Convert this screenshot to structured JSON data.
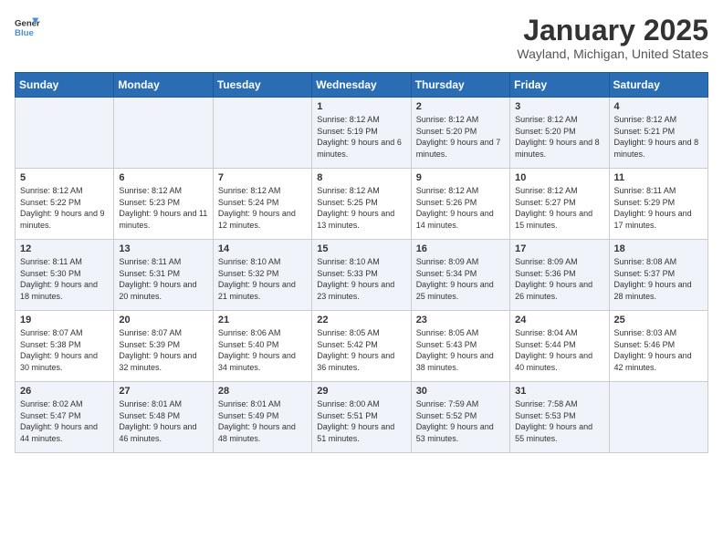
{
  "logo": {
    "general": "General",
    "blue": "Blue"
  },
  "header": {
    "title": "January 2025",
    "subtitle": "Wayland, Michigan, United States"
  },
  "weekdays": [
    "Sunday",
    "Monday",
    "Tuesday",
    "Wednesday",
    "Thursday",
    "Friday",
    "Saturday"
  ],
  "weeks": [
    [
      {
        "day": "",
        "sunrise": "",
        "sunset": "",
        "daylight": ""
      },
      {
        "day": "",
        "sunrise": "",
        "sunset": "",
        "daylight": ""
      },
      {
        "day": "",
        "sunrise": "",
        "sunset": "",
        "daylight": ""
      },
      {
        "day": "1",
        "sunrise": "Sunrise: 8:12 AM",
        "sunset": "Sunset: 5:19 PM",
        "daylight": "Daylight: 9 hours and 6 minutes."
      },
      {
        "day": "2",
        "sunrise": "Sunrise: 8:12 AM",
        "sunset": "Sunset: 5:20 PM",
        "daylight": "Daylight: 9 hours and 7 minutes."
      },
      {
        "day": "3",
        "sunrise": "Sunrise: 8:12 AM",
        "sunset": "Sunset: 5:20 PM",
        "daylight": "Daylight: 9 hours and 8 minutes."
      },
      {
        "day": "4",
        "sunrise": "Sunrise: 8:12 AM",
        "sunset": "Sunset: 5:21 PM",
        "daylight": "Daylight: 9 hours and 8 minutes."
      }
    ],
    [
      {
        "day": "5",
        "sunrise": "Sunrise: 8:12 AM",
        "sunset": "Sunset: 5:22 PM",
        "daylight": "Daylight: 9 hours and 9 minutes."
      },
      {
        "day": "6",
        "sunrise": "Sunrise: 8:12 AM",
        "sunset": "Sunset: 5:23 PM",
        "daylight": "Daylight: 9 hours and 11 minutes."
      },
      {
        "day": "7",
        "sunrise": "Sunrise: 8:12 AM",
        "sunset": "Sunset: 5:24 PM",
        "daylight": "Daylight: 9 hours and 12 minutes."
      },
      {
        "day": "8",
        "sunrise": "Sunrise: 8:12 AM",
        "sunset": "Sunset: 5:25 PM",
        "daylight": "Daylight: 9 hours and 13 minutes."
      },
      {
        "day": "9",
        "sunrise": "Sunrise: 8:12 AM",
        "sunset": "Sunset: 5:26 PM",
        "daylight": "Daylight: 9 hours and 14 minutes."
      },
      {
        "day": "10",
        "sunrise": "Sunrise: 8:12 AM",
        "sunset": "Sunset: 5:27 PM",
        "daylight": "Daylight: 9 hours and 15 minutes."
      },
      {
        "day": "11",
        "sunrise": "Sunrise: 8:11 AM",
        "sunset": "Sunset: 5:29 PM",
        "daylight": "Daylight: 9 hours and 17 minutes."
      }
    ],
    [
      {
        "day": "12",
        "sunrise": "Sunrise: 8:11 AM",
        "sunset": "Sunset: 5:30 PM",
        "daylight": "Daylight: 9 hours and 18 minutes."
      },
      {
        "day": "13",
        "sunrise": "Sunrise: 8:11 AM",
        "sunset": "Sunset: 5:31 PM",
        "daylight": "Daylight: 9 hours and 20 minutes."
      },
      {
        "day": "14",
        "sunrise": "Sunrise: 8:10 AM",
        "sunset": "Sunset: 5:32 PM",
        "daylight": "Daylight: 9 hours and 21 minutes."
      },
      {
        "day": "15",
        "sunrise": "Sunrise: 8:10 AM",
        "sunset": "Sunset: 5:33 PM",
        "daylight": "Daylight: 9 hours and 23 minutes."
      },
      {
        "day": "16",
        "sunrise": "Sunrise: 8:09 AM",
        "sunset": "Sunset: 5:34 PM",
        "daylight": "Daylight: 9 hours and 25 minutes."
      },
      {
        "day": "17",
        "sunrise": "Sunrise: 8:09 AM",
        "sunset": "Sunset: 5:36 PM",
        "daylight": "Daylight: 9 hours and 26 minutes."
      },
      {
        "day": "18",
        "sunrise": "Sunrise: 8:08 AM",
        "sunset": "Sunset: 5:37 PM",
        "daylight": "Daylight: 9 hours and 28 minutes."
      }
    ],
    [
      {
        "day": "19",
        "sunrise": "Sunrise: 8:07 AM",
        "sunset": "Sunset: 5:38 PM",
        "daylight": "Daylight: 9 hours and 30 minutes."
      },
      {
        "day": "20",
        "sunrise": "Sunrise: 8:07 AM",
        "sunset": "Sunset: 5:39 PM",
        "daylight": "Daylight: 9 hours and 32 minutes."
      },
      {
        "day": "21",
        "sunrise": "Sunrise: 8:06 AM",
        "sunset": "Sunset: 5:40 PM",
        "daylight": "Daylight: 9 hours and 34 minutes."
      },
      {
        "day": "22",
        "sunrise": "Sunrise: 8:05 AM",
        "sunset": "Sunset: 5:42 PM",
        "daylight": "Daylight: 9 hours and 36 minutes."
      },
      {
        "day": "23",
        "sunrise": "Sunrise: 8:05 AM",
        "sunset": "Sunset: 5:43 PM",
        "daylight": "Daylight: 9 hours and 38 minutes."
      },
      {
        "day": "24",
        "sunrise": "Sunrise: 8:04 AM",
        "sunset": "Sunset: 5:44 PM",
        "daylight": "Daylight: 9 hours and 40 minutes."
      },
      {
        "day": "25",
        "sunrise": "Sunrise: 8:03 AM",
        "sunset": "Sunset: 5:46 PM",
        "daylight": "Daylight: 9 hours and 42 minutes."
      }
    ],
    [
      {
        "day": "26",
        "sunrise": "Sunrise: 8:02 AM",
        "sunset": "Sunset: 5:47 PM",
        "daylight": "Daylight: 9 hours and 44 minutes."
      },
      {
        "day": "27",
        "sunrise": "Sunrise: 8:01 AM",
        "sunset": "Sunset: 5:48 PM",
        "daylight": "Daylight: 9 hours and 46 minutes."
      },
      {
        "day": "28",
        "sunrise": "Sunrise: 8:01 AM",
        "sunset": "Sunset: 5:49 PM",
        "daylight": "Daylight: 9 hours and 48 minutes."
      },
      {
        "day": "29",
        "sunrise": "Sunrise: 8:00 AM",
        "sunset": "Sunset: 5:51 PM",
        "daylight": "Daylight: 9 hours and 51 minutes."
      },
      {
        "day": "30",
        "sunrise": "Sunrise: 7:59 AM",
        "sunset": "Sunset: 5:52 PM",
        "daylight": "Daylight: 9 hours and 53 minutes."
      },
      {
        "day": "31",
        "sunrise": "Sunrise: 7:58 AM",
        "sunset": "Sunset: 5:53 PM",
        "daylight": "Daylight: 9 hours and 55 minutes."
      },
      {
        "day": "",
        "sunrise": "",
        "sunset": "",
        "daylight": ""
      }
    ]
  ]
}
